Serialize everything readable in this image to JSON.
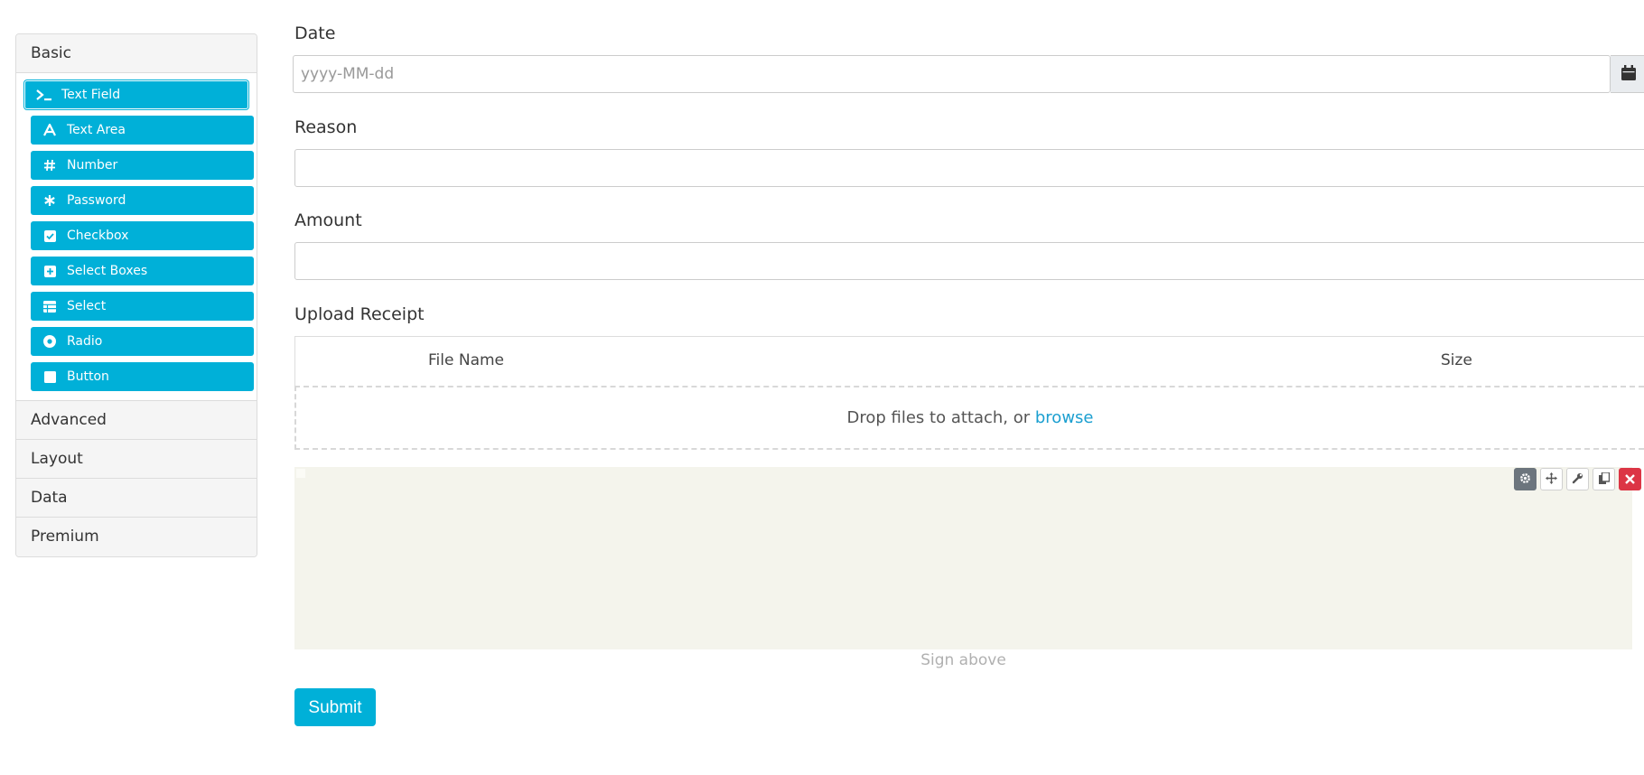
{
  "sidebar": {
    "groups": [
      {
        "label": "Basic"
      },
      {
        "label": "Advanced"
      },
      {
        "label": "Layout"
      },
      {
        "label": "Data"
      },
      {
        "label": "Premium"
      }
    ],
    "components": [
      {
        "label": "Text Field",
        "icon": "terminal-icon"
      },
      {
        "label": "Text Area",
        "icon": "font-icon"
      },
      {
        "label": "Number",
        "icon": "hashtag-icon"
      },
      {
        "label": "Password",
        "icon": "asterisk-icon"
      },
      {
        "label": "Checkbox",
        "icon": "check-square-icon"
      },
      {
        "label": "Select Boxes",
        "icon": "plus-square-icon"
      },
      {
        "label": "Select",
        "icon": "table-icon"
      },
      {
        "label": "Radio",
        "icon": "dot-circle-icon"
      },
      {
        "label": "Button",
        "icon": "stop-icon"
      }
    ]
  },
  "form": {
    "date": {
      "label": "Date",
      "placeholder": "yyyy-MM-dd"
    },
    "reason": {
      "label": "Reason",
      "value": ""
    },
    "amount": {
      "label": "Amount",
      "value": ""
    },
    "upload": {
      "label": "Upload Receipt",
      "columns": [
        "File Name",
        "Size"
      ],
      "drop_text": "Drop files to attach, or ",
      "browse_link": "browse"
    },
    "signature": {
      "hint": "Sign above"
    },
    "submit_label": "Submit"
  },
  "colors": {
    "accent": "#00b0d8",
    "danger": "#dc3545",
    "link": "#1b9fd0",
    "signature_bg": "#f4f4ec"
  }
}
